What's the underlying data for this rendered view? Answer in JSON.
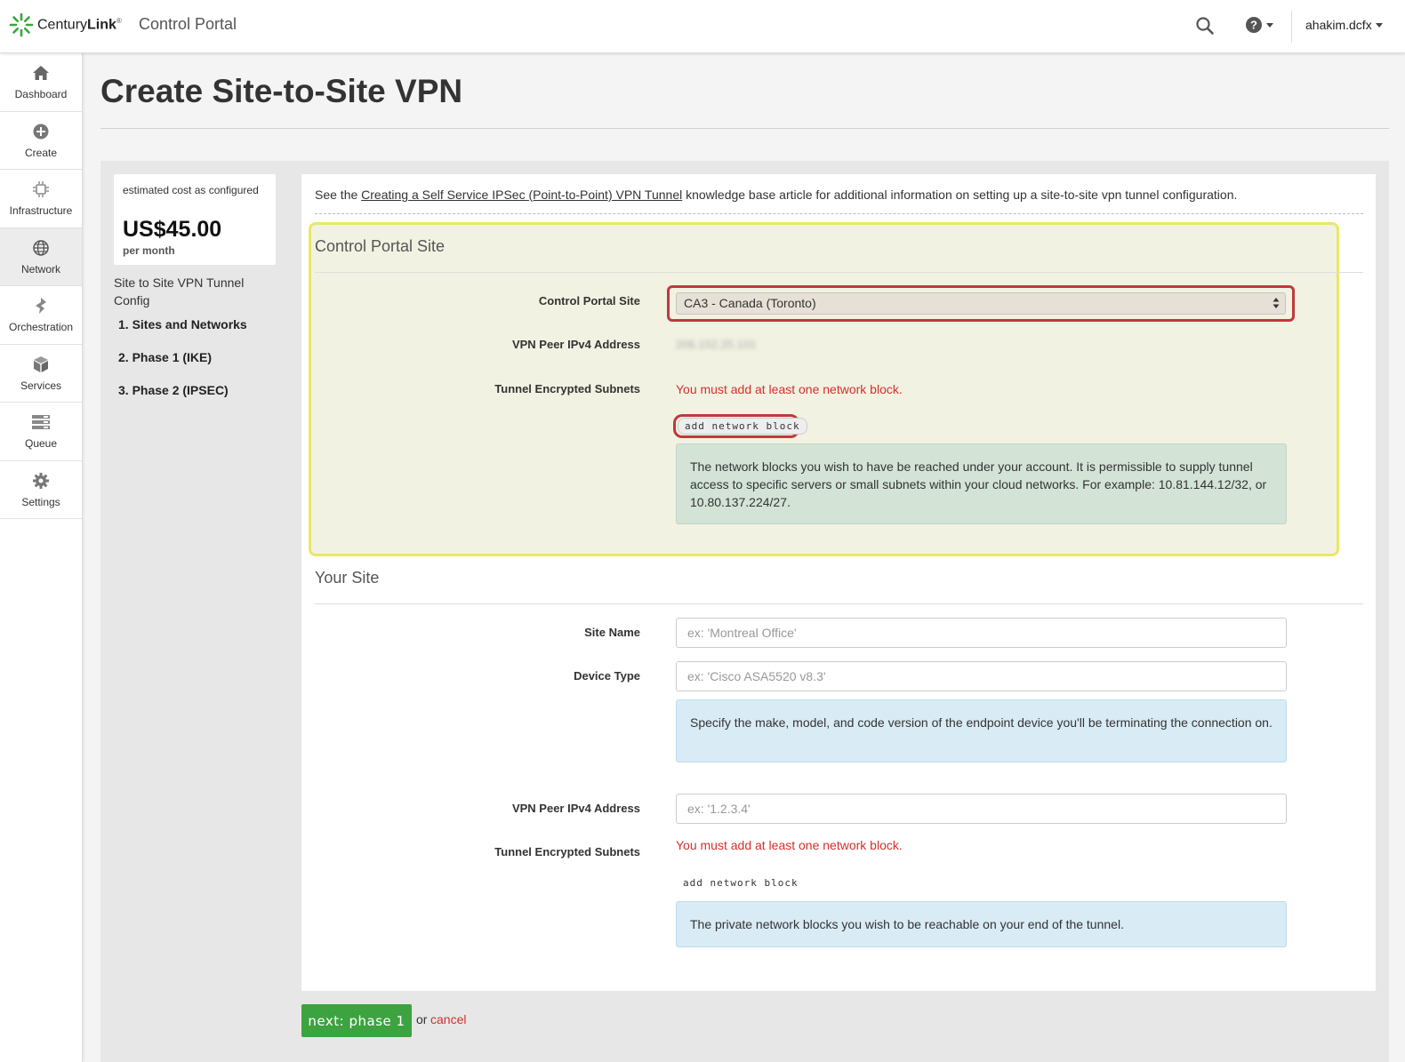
{
  "topbar": {
    "logo_text_regular": "Century",
    "logo_text_bold": "Link",
    "logo_sup": "®",
    "portal_title": "Control Portal",
    "username": "ahakim.dcfx",
    "icons": [
      "search-icon",
      "help-icon",
      "chevron-down-icon"
    ]
  },
  "sidebar": {
    "items": [
      {
        "label": "Dashboard",
        "icon": "home-icon",
        "active": false
      },
      {
        "label": "Create",
        "icon": "plus-circle-icon",
        "active": false
      },
      {
        "label": "Infrastructure",
        "icon": "chip-icon",
        "active": false
      },
      {
        "label": "Network",
        "icon": "globe-icon",
        "active": true
      },
      {
        "label": "Orchestration",
        "icon": "orchestration-icon",
        "active": false
      },
      {
        "label": "Services",
        "icon": "cube-icon",
        "active": false
      },
      {
        "label": "Queue",
        "icon": "queue-icon",
        "active": false
      },
      {
        "label": "Settings",
        "icon": "gear-icon",
        "active": false
      }
    ]
  },
  "page": {
    "title": "Create Site-to-Site VPN"
  },
  "cost": {
    "label": "estimated cost as configured",
    "amount": "US$45.00",
    "period": "per month"
  },
  "steps": {
    "title": "Site to Site VPN Tunnel Config",
    "items": [
      "1. Sites and Networks",
      "2. Phase 1 (IKE)",
      "3. Phase 2 (IPSEC)"
    ]
  },
  "intro": {
    "prefix": "See the ",
    "link": "Creating a Self Service IPSec (Point-to-Point) VPN Tunnel",
    "suffix": " knowledge base article for additional information on setting up a site-to-site vpn tunnel configuration."
  },
  "control_portal_site": {
    "section_title": "Control Portal Site",
    "site_label": "Control Portal Site",
    "site_value": "CA3 - Canada (Toronto)",
    "peer_label": "VPN Peer IPv4 Address",
    "peer_value_blurred": "206.152.25.101",
    "subnets_label": "Tunnel Encrypted Subnets",
    "error": "You must add at least one network block.",
    "add_button": "add network block",
    "help": "The network blocks you wish to have be reached under your account. It is permissible to supply tunnel access to specific servers or small subnets within your cloud networks. For example: 10.81.144.12/32, or 10.80.137.224/27."
  },
  "your_site": {
    "section_title": "Your Site",
    "site_name_label": "Site Name",
    "site_name_placeholder": "ex: 'Montreal Office'",
    "device_type_label": "Device Type",
    "device_type_placeholder": "ex: 'Cisco ASA5520 v8.3'",
    "device_help": "Specify the make, model, and code version of the endpoint device you'll be terminating the connection on.",
    "peer_label": "VPN Peer IPv4 Address",
    "peer_placeholder": "ex: '1.2.3.4'",
    "subnets_label": "Tunnel Encrypted Subnets",
    "error": "You must add at least one network block.",
    "add_button": "add network block",
    "subnets_help": "The private network blocks you wish to be reachable on your end of the tunnel."
  },
  "actions": {
    "next_label": "next: phase 1",
    "or_text": "or",
    "cancel_label": "cancel"
  },
  "colors": {
    "accent_green": "#3ca340",
    "error_red": "#d3302a",
    "highlight_yellow": "#e8e867",
    "highlight_red": "#c0393b"
  }
}
